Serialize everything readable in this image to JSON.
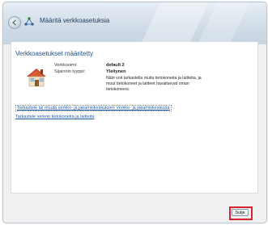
{
  "window": {
    "title": "Määritä verkkoasetuksia",
    "close_glyph": "✕"
  },
  "main": {
    "heading": "Verkkoasetukset määritetty",
    "network_name_label": "Verkkonimi:",
    "network_name_value": "default  2",
    "location_type_label": "Sijainnin tyyppi:",
    "location_type_value": "Yleitynen",
    "description": "Näin voit tarkastella muita tietokoneita ja laitteita, ja muut tietokoneet ja laitteet havaitsevat oman tietokoneesi.",
    "links": [
      "Tarkastele tai muuta verkko- ja jakamiskeskuksen Verkko- ja jakamiskeskusta",
      "Tarkastele verkon tietokoneita ja laitteita"
    ]
  },
  "footer": {
    "close_button_label": "Sulje"
  },
  "icons": {
    "back": "back-arrow-icon",
    "network": "network-icon",
    "home": "home-network-icon"
  },
  "colors": {
    "link": "#1d5ea8",
    "heading": "#1f4e8c",
    "highlight": "#d9242f"
  }
}
